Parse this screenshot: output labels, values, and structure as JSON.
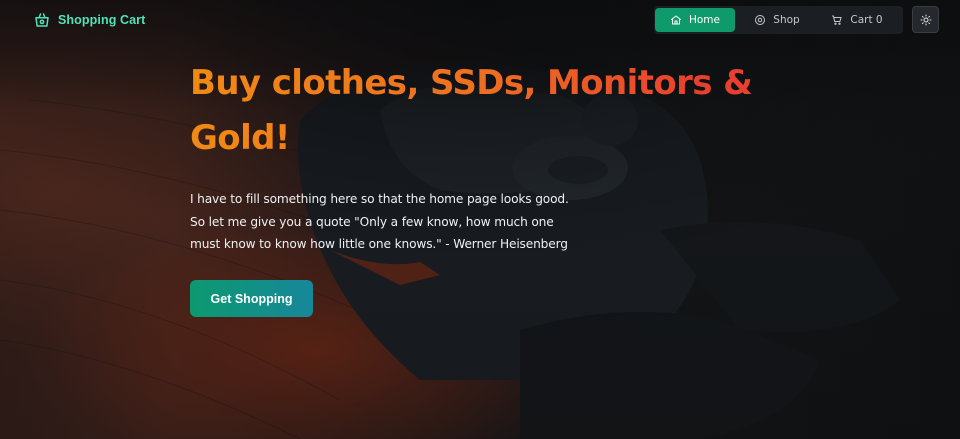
{
  "navbar": {
    "brand": {
      "label": "Shopping Cart",
      "icon": "basket-icon"
    },
    "items": [
      {
        "label": "Home",
        "icon": "home-icon",
        "active": true
      },
      {
        "label": "Shop",
        "icon": "shop-icon",
        "active": false
      },
      {
        "label": "Cart 0",
        "icon": "cart-icon",
        "active": false
      }
    ],
    "theme_toggle_icon": "sun-icon"
  },
  "hero": {
    "title": "Buy clothes, SSDs, Monitors & Gold!",
    "text": "I have to fill something here so that the home page looks good. So let me give you a quote \"Only a few know, how much one must know to know how little one knows.\" - Werner Heisenberg",
    "button_label": "Get Shopping"
  },
  "colors": {
    "accent": "#0f9a6c",
    "brand_text": "#4fe3b8",
    "title_gradient_start": "#f08a14",
    "title_gradient_end": "#e8402e",
    "background": "#121416"
  }
}
